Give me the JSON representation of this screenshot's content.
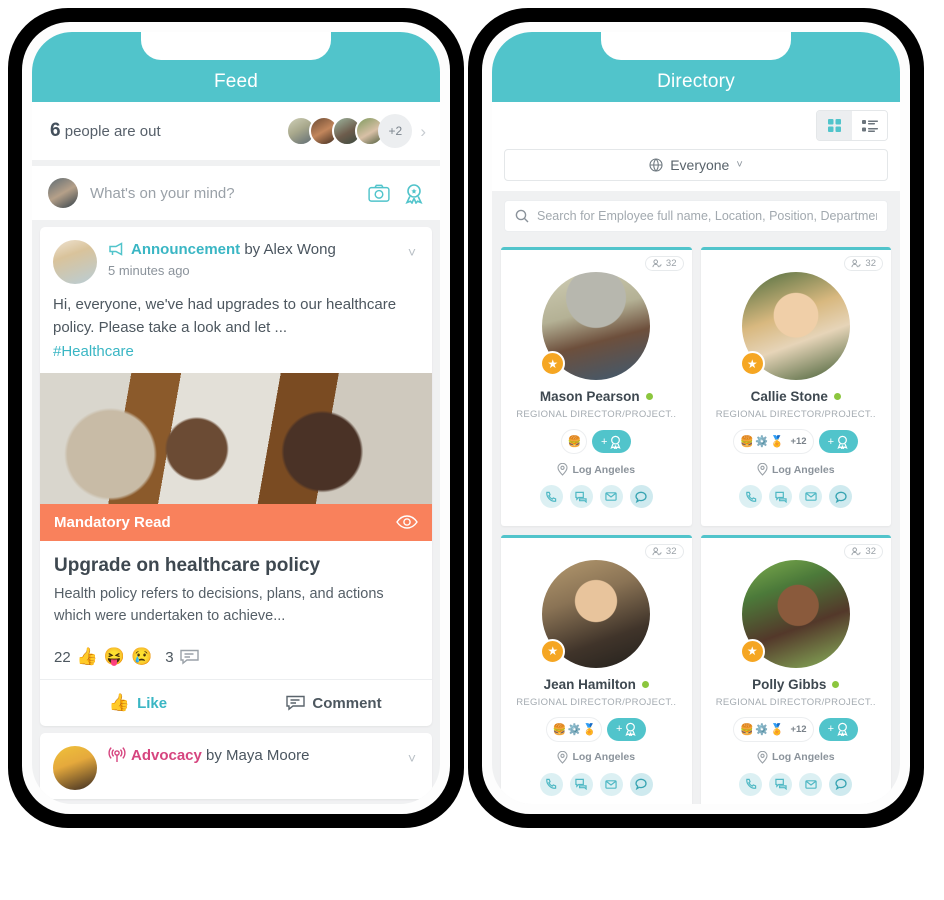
{
  "colors": {
    "teal": "#51c4cb",
    "orange": "#f9815c",
    "pink": "#d6457f",
    "online_green": "#8cc63e",
    "star_gold": "#f5a623",
    "page_bg": "#f0f1f2"
  },
  "left_phone": {
    "header": {
      "title": "Feed"
    },
    "out_bar": {
      "count": "6",
      "label": "people are out",
      "extra_count": "+2",
      "chevron": "chevron-right-icon"
    },
    "composer": {
      "placeholder": "What's on your mind?",
      "camera_icon": "camera-icon",
      "badge_icon": "award-badge-icon"
    },
    "posts": [
      {
        "type_label": "Announcement",
        "by_text": "by Alex Wong",
        "time": "5 minutes ago",
        "icon": "megaphone-icon",
        "body": "Hi, everyone, we've had upgrades to our healthcare policy. Please take a look and let ...",
        "hashtag": "#Healthcare",
        "banner": {
          "label": "Mandatory Read",
          "eye_icon": "eye-icon"
        },
        "article": {
          "title": "Upgrade on healthcare policy",
          "excerpt": "Health policy refers to decisions, plans, and actions which were undertaken to achieve..."
        },
        "reactions": {
          "like_count": "22",
          "emojis": [
            "👍",
            "😝",
            "😢"
          ],
          "comment_count": "3"
        },
        "actions": {
          "like": "Like",
          "comment": "Comment"
        }
      },
      {
        "type_label": "Advocacy",
        "by_text": "by Maya Moore",
        "icon": "broadcast-icon"
      }
    ]
  },
  "right_phone": {
    "header": {
      "title": "Directory"
    },
    "view_toggle": {
      "grid_label": "grid-view",
      "list_label": "list-view",
      "active": "grid"
    },
    "filter": {
      "label": "Everyone",
      "icon": "globe-icon",
      "chevron": "chevron-down-icon"
    },
    "search": {
      "placeholder": "Search for Employee full name, Location, Position, Department a",
      "icon": "search-icon"
    },
    "people": [
      {
        "name": "Mason Pearson",
        "role": "REGIONAL DIRECTOR/PROJECT..",
        "location": "Log Angeles",
        "connections": "32",
        "status": "online",
        "badges": [
          "🍔"
        ],
        "badge_more": "",
        "add_badge_label": "+",
        "contacts": [
          "phone-icon",
          "chat-icon",
          "email-icon",
          "message-icon"
        ]
      },
      {
        "name": "Callie Stone",
        "role": "REGIONAL DIRECTOR/PROJECT..",
        "location": "Log Angeles",
        "connections": "32",
        "status": "online",
        "badges": [
          "🍔",
          "⚙️",
          "🏅"
        ],
        "badge_more": "+12",
        "add_badge_label": "+",
        "contacts": [
          "phone-icon",
          "chat-icon",
          "email-icon",
          "message-icon"
        ]
      },
      {
        "name": "Jean Hamilton",
        "role": "REGIONAL DIRECTOR/PROJECT..",
        "location": "Log Angeles",
        "connections": "32",
        "status": "online",
        "badges": [
          "🍔",
          "⚙️",
          "🏅"
        ],
        "badge_more": "",
        "add_badge_label": "+",
        "contacts": [
          "phone-icon",
          "chat-icon",
          "email-icon",
          "message-icon"
        ]
      },
      {
        "name": "Polly Gibbs",
        "role": "REGIONAL DIRECTOR/PROJECT..",
        "location": "Log Angeles",
        "connections": "32",
        "status": "online",
        "badges": [
          "🍔",
          "⚙️",
          "🏅"
        ],
        "badge_more": "+12",
        "add_badge_label": "+",
        "contacts": [
          "phone-icon",
          "chat-icon",
          "email-icon",
          "message-icon"
        ]
      }
    ]
  }
}
